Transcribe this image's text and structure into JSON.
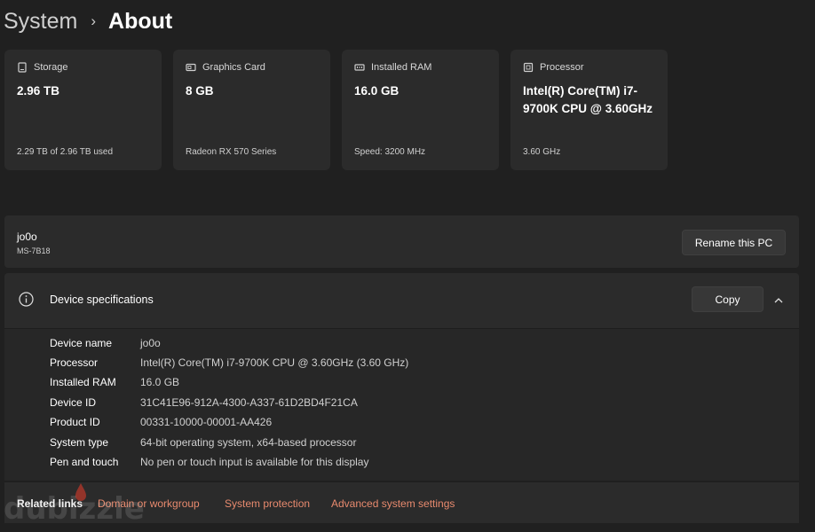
{
  "breadcrumb": {
    "parent": "System",
    "separator": "›",
    "current": "About"
  },
  "cards": [
    {
      "icon": "storage-icon",
      "label": "Storage",
      "value": "2.96 TB",
      "sub": "2.29 TB of 2.96 TB used"
    },
    {
      "icon": "graphics-card-icon",
      "label": "Graphics Card",
      "value": "8 GB",
      "sub": "Radeon RX 570 Series"
    },
    {
      "icon": "ram-icon",
      "label": "Installed RAM",
      "value": "16.0 GB",
      "sub": "Speed: 3200 MHz"
    },
    {
      "icon": "processor-icon",
      "label": "Processor",
      "value": "Intel(R) Core(TM) i7-9700K CPU @ 3.60GHz",
      "sub": "3.60 GHz"
    }
  ],
  "pc": {
    "name": "jo0o",
    "model": "MS-7B18",
    "rename_label": "Rename this PC"
  },
  "specs": {
    "title": "Device specifications",
    "copy_label": "Copy",
    "rows": [
      {
        "key": "Device name",
        "value": "jo0o"
      },
      {
        "key": "Processor",
        "value": "Intel(R) Core(TM) i7-9700K CPU @ 3.60GHz (3.60 GHz)"
      },
      {
        "key": "Installed RAM",
        "value": "16.0 GB"
      },
      {
        "key": "Device ID",
        "value": "31C41E96-912A-4300-A337-61D2BD4F21CA"
      },
      {
        "key": "Product ID",
        "value": "00331-10000-00001-AA426"
      },
      {
        "key": "System type",
        "value": "64-bit operating system, x64-based processor"
      },
      {
        "key": "Pen and touch",
        "value": "No pen or touch input is available for this display"
      }
    ]
  },
  "related": {
    "label": "Related links",
    "links": [
      "Domain or workgroup",
      "System protection",
      "Advanced system settings"
    ]
  },
  "watermark": "dubizzle",
  "colors": {
    "background": "#202020",
    "card": "#2b2b2b",
    "link": "#e88a6e",
    "watermark_drop": "#c0392b"
  }
}
